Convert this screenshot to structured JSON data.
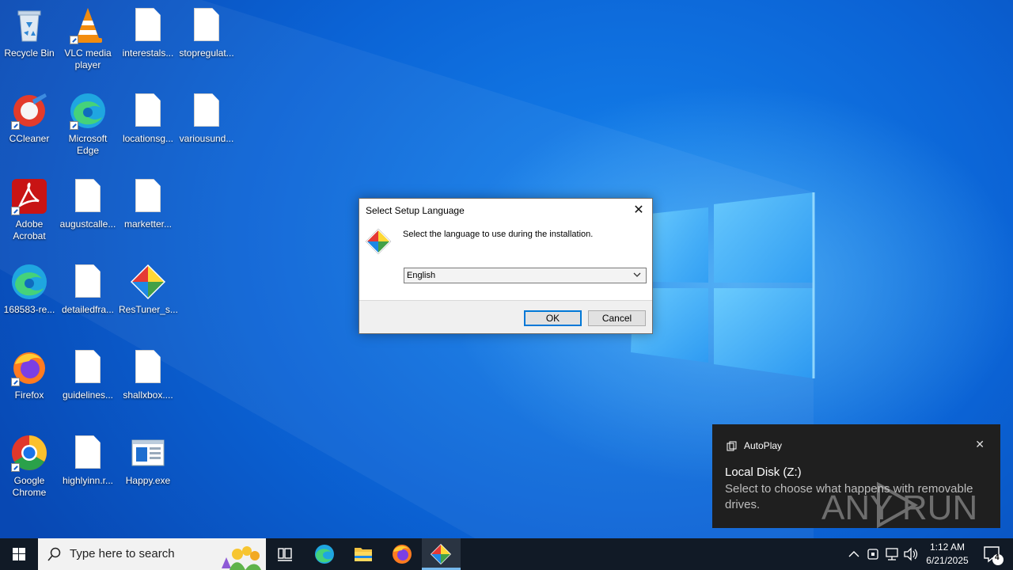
{
  "desktop": {
    "icons": [
      {
        "label": "Recycle Bin"
      },
      {
        "label": "VLC media player"
      },
      {
        "label": "interestals..."
      },
      {
        "label": "stopregulat..."
      },
      {
        "label": "CCleaner"
      },
      {
        "label": "Microsoft Edge"
      },
      {
        "label": "locationsg..."
      },
      {
        "label": "variousund..."
      },
      {
        "label": "Adobe Acrobat"
      },
      {
        "label": "augustcalle..."
      },
      {
        "label": "marketter..."
      },
      {
        "label": "168583-re..."
      },
      {
        "label": "detailedfra..."
      },
      {
        "label": "ResTuner_s..."
      },
      {
        "label": "Firefox"
      },
      {
        "label": "guidelines..."
      },
      {
        "label": "shallxbox...."
      },
      {
        "label": "Google Chrome"
      },
      {
        "label": "highlyinn.r..."
      },
      {
        "label": "Happy.exe"
      }
    ]
  },
  "dialog": {
    "title": "Select Setup Language",
    "close_symbol": "✕",
    "message": "Select the language to use during the installation.",
    "selected_language": "English",
    "ok_label": "OK",
    "cancel_label": "Cancel"
  },
  "toast": {
    "app_name": "AutoPlay",
    "close_symbol": "✕",
    "heading": "Local Disk (Z:)",
    "body": "Select to choose what happens with removable drives."
  },
  "watermark": {
    "text": "ANY RUN"
  },
  "taskbar": {
    "search_placeholder": "Type here to search",
    "time": "1:12 AM",
    "date": "6/21/2025",
    "notification_count": "4"
  },
  "colors": {
    "accent": "#0078d7",
    "taskbar_bg": "#111a26",
    "toast_bg": "#1f1f1f"
  }
}
